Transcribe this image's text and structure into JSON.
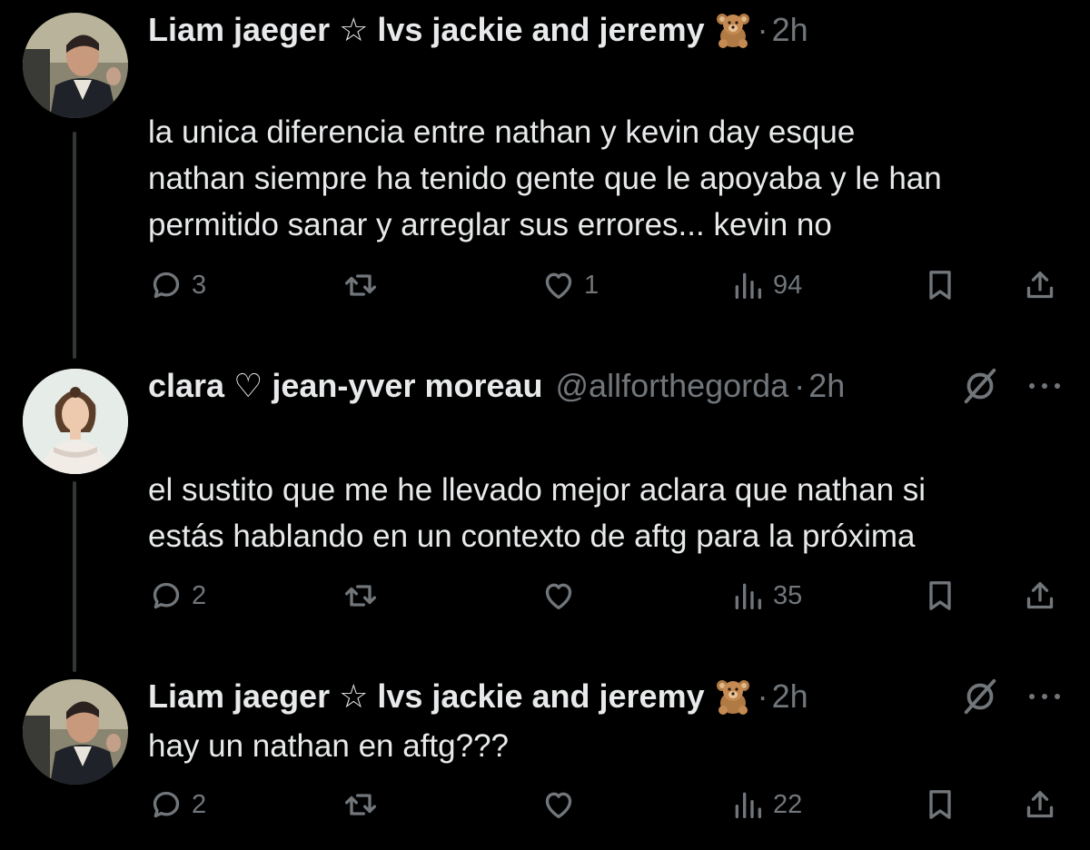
{
  "tweets": [
    {
      "name": "Liam jaeger ☆ lvs jackie and jeremy",
      "handle": "",
      "dot": "·",
      "time": "2h",
      "text_lines": [
        "la unica diferencia entre nathan y kevin day esque",
        "nathan siempre ha tenido gente que le apoyaba y le han",
        "permitido sanar y arreglar sus errores... kevin no"
      ],
      "replies": "3",
      "retweets": "",
      "likes": "1",
      "views": "94"
    },
    {
      "name": "clara ♡ jean-yver moreau",
      "handle": "@allforthegorda",
      "dot": "·",
      "time": "2h",
      "text_lines": [
        "el sustito que me he llevado mejor aclara que nathan si",
        "estás hablando en un contexto de aftg para la próxima"
      ],
      "replies": "2",
      "retweets": "",
      "likes": "",
      "views": "35"
    },
    {
      "name": "Liam jaeger ☆ lvs jackie and jeremy",
      "handle": "",
      "dot": "·",
      "time": "2h",
      "text_lines": [
        "hay un nathan en aftg???"
      ],
      "replies": "2",
      "retweets": "",
      "likes": "",
      "views": "22"
    }
  ],
  "icons": {
    "reply": "reply-icon",
    "retweet": "retweet-icon",
    "like": "like-icon",
    "views": "views-icon",
    "bookmark": "bookmark-icon",
    "share": "share-icon",
    "grok": "grok-icon",
    "more": "more-icon",
    "emoji": "teddy-bear-emoji"
  },
  "colors": {
    "background": "#000000",
    "text": "#e7e9ea",
    "secondary": "#71767b",
    "thread_line": "#333639"
  }
}
